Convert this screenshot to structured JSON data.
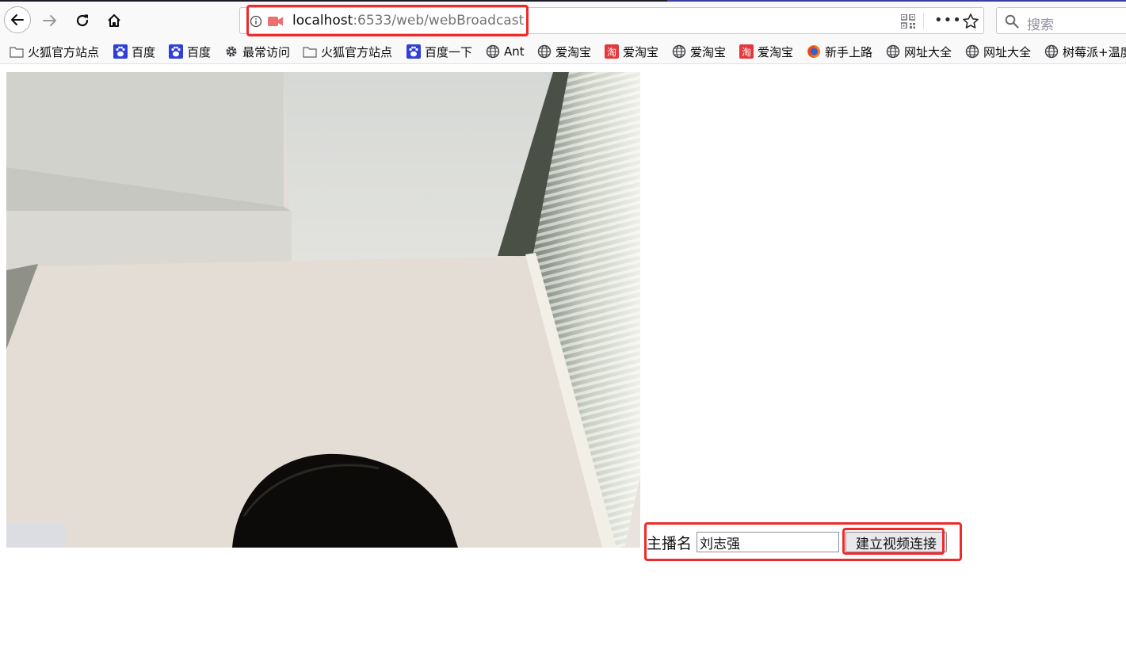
{
  "browser": {
    "url_host": "localhost",
    "url_rest": ":6533/web/webBroadcast",
    "search_placeholder": "搜索"
  },
  "bookmarks": [
    {
      "label": "火狐官方站点",
      "icon": "folder-icon"
    },
    {
      "label": "百度",
      "icon": "baidu-paw-icon"
    },
    {
      "label": "百度",
      "icon": "baidu-paw-icon"
    },
    {
      "label": "最常访问",
      "icon": "gear-icon"
    },
    {
      "label": "火狐官方站点",
      "icon": "folder-icon"
    },
    {
      "label": "百度一下",
      "icon": "baidu-paw-icon"
    },
    {
      "label": "Ant",
      "icon": "globe-icon"
    },
    {
      "label": "爱淘宝",
      "icon": "globe-icon"
    },
    {
      "label": "爱淘宝",
      "icon": "taobao-icon"
    },
    {
      "label": "爱淘宝",
      "icon": "globe-icon"
    },
    {
      "label": "爱淘宝",
      "icon": "taobao-icon"
    },
    {
      "label": "新手上路",
      "icon": "firefox-icon"
    },
    {
      "label": "网址大全",
      "icon": "globe-icon"
    },
    {
      "label": "网址大全",
      "icon": "globe-icon"
    },
    {
      "label": "树莓派+温度",
      "icon": "globe-icon"
    }
  ],
  "page": {
    "form_label": "主播名",
    "name_value": "刘志强",
    "connect_button": "建立视频连接"
  },
  "colors": {
    "highlight": "#ee2a2a",
    "toolbar_bg": "#f9f9fa"
  }
}
